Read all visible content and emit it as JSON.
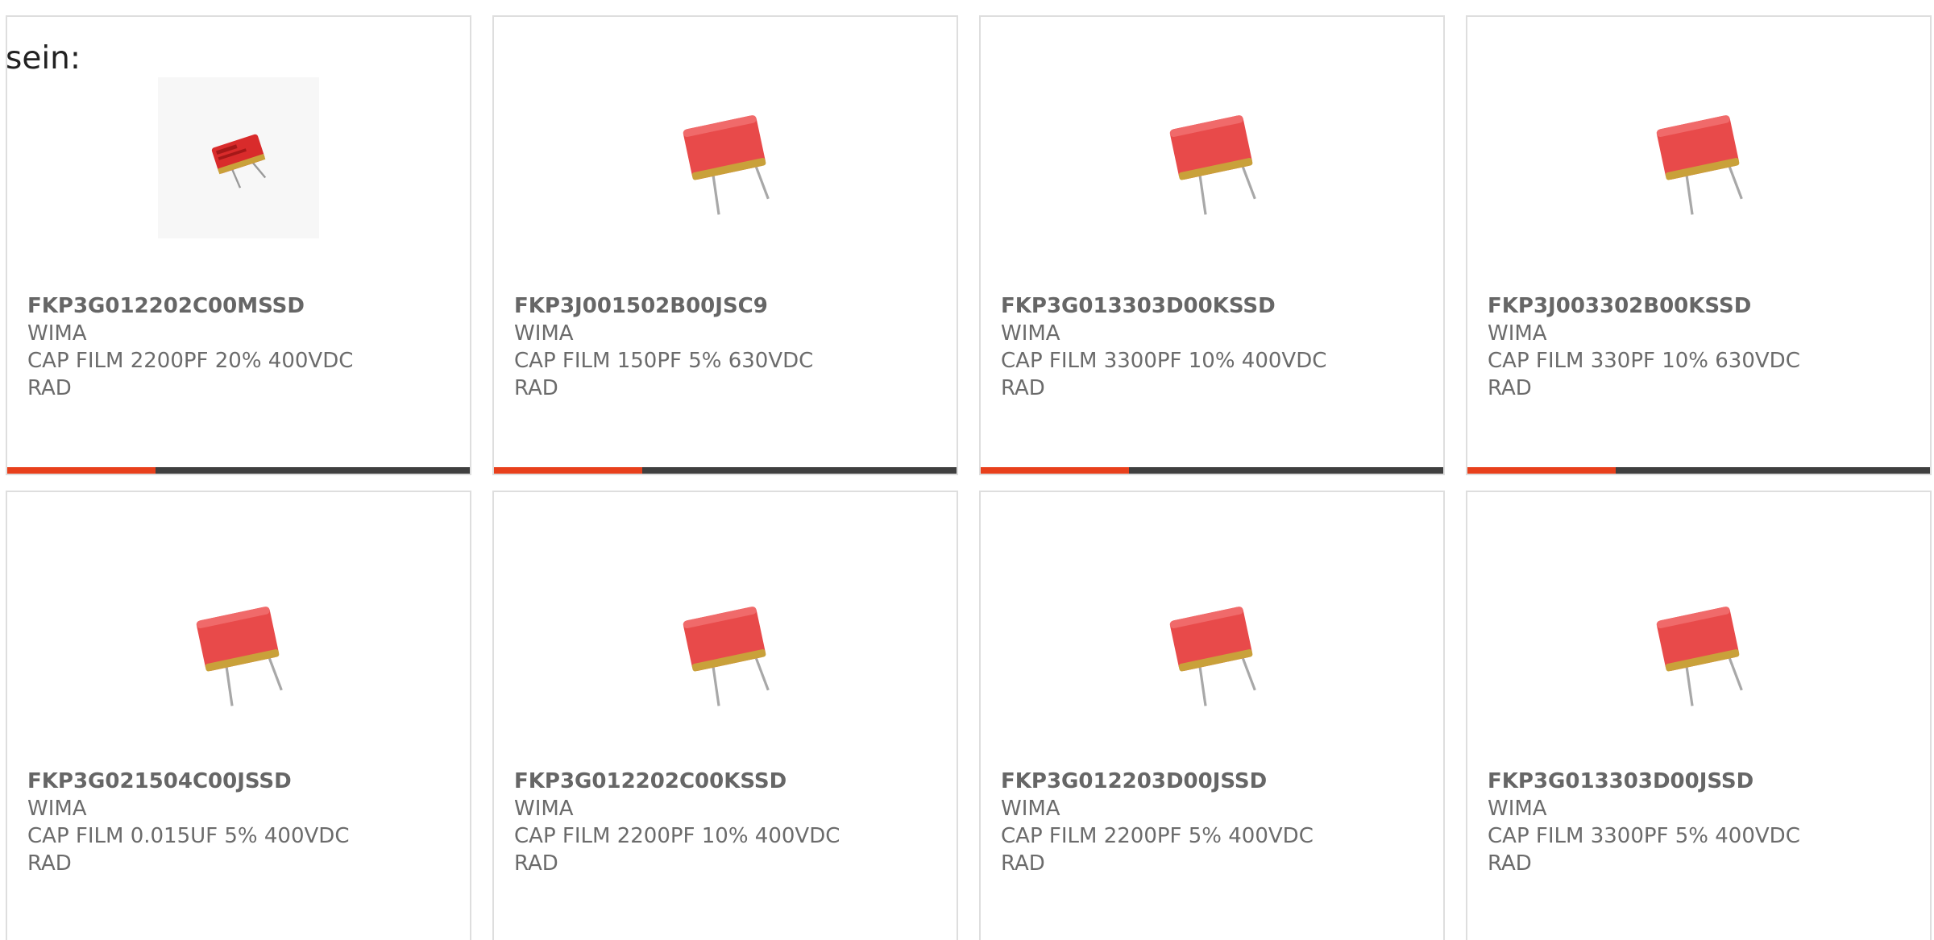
{
  "intro_text": "sein:",
  "colors": {
    "accent": "#e8401c",
    "track": "#3f3f3f",
    "card_border": "#dedede",
    "text": "#6b6b6b"
  },
  "products": [
    {
      "part": "FKP3G012202C00MSSD",
      "brand": "WIMA",
      "desc": "CAP FILM 2200PF 20% 400VDC\nRAD",
      "image": "capacitor-photo-small",
      "progress": 0.32
    },
    {
      "part": "FKP3J001502B00JSC9",
      "brand": "WIMA",
      "desc": "CAP FILM 150PF 5% 630VDC\nRAD",
      "image": "capacitor-photo",
      "progress": 0.32
    },
    {
      "part": "FKP3G013303D00KSSD",
      "brand": "WIMA",
      "desc": "CAP FILM 3300PF 10% 400VDC\nRAD",
      "image": "capacitor-photo",
      "progress": 0.32
    },
    {
      "part": "FKP3J003302B00KSSD",
      "brand": "WIMA",
      "desc": "CAP FILM 330PF 10% 630VDC\nRAD",
      "image": "capacitor-photo",
      "progress": 0.32
    },
    {
      "part": "FKP3G021504C00JSSD",
      "brand": "WIMA",
      "desc": "CAP FILM 0.015UF 5% 400VDC\nRAD",
      "image": "capacitor-photo"
    },
    {
      "part": "FKP3G012202C00KSSD",
      "brand": "WIMA",
      "desc": "CAP FILM 2200PF 10% 400VDC\nRAD",
      "image": "capacitor-photo"
    },
    {
      "part": "FKP3G012203D00JSSD",
      "brand": "WIMA",
      "desc": "CAP FILM 2200PF 5% 400VDC\nRAD",
      "image": "capacitor-photo"
    },
    {
      "part": "FKP3G013303D00JSSD",
      "brand": "WIMA",
      "desc": "CAP FILM 3300PF 5% 400VDC\nRAD",
      "image": "capacitor-photo"
    }
  ]
}
